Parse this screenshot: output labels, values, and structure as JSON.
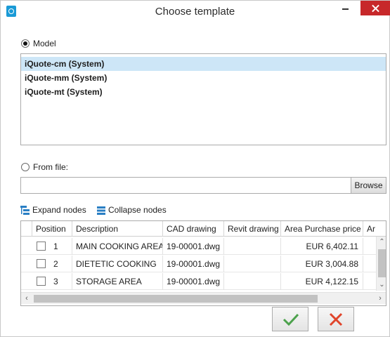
{
  "window": {
    "title": "Choose template"
  },
  "model_option": {
    "label": "Model",
    "selected": true
  },
  "model_list": {
    "items": [
      {
        "label": "iQuote-cm (System)",
        "selected": true
      },
      {
        "label": "iQuote-mm (System)",
        "selected": false
      },
      {
        "label": "iQuote-mt (System)",
        "selected": false
      }
    ]
  },
  "file_option": {
    "label": "From file:",
    "selected": false,
    "value": "",
    "browse_label": "Browse"
  },
  "tree_toolbar": {
    "expand_label": "Expand nodes",
    "collapse_label": "Collapse nodes"
  },
  "grid": {
    "columns": [
      "Position",
      "Description",
      "CAD drawing",
      "Revit drawing",
      "Area Purchase price",
      "Ar"
    ],
    "rows": [
      {
        "position": "1",
        "description": "MAIN COOKING AREA",
        "cad": "19-00001.dwg",
        "revit": "",
        "price": "EUR 6,402.11",
        "checked": false
      },
      {
        "position": "2",
        "description": "DIETETIC COOKING",
        "cad": "19-00001.dwg",
        "revit": "",
        "price": "EUR 3,004.88",
        "checked": false
      },
      {
        "position": "3",
        "description": "STORAGE AREA",
        "cad": "19-00001.dwg",
        "revit": "",
        "price": "EUR 4,122.15",
        "checked": false
      }
    ]
  },
  "colors": {
    "selection": "#cde6f7",
    "close_button": "#c7282a",
    "ok_icon": "#4ca24c",
    "cancel_icon": "#e0442a",
    "app_icon": "#1a9ad6"
  }
}
